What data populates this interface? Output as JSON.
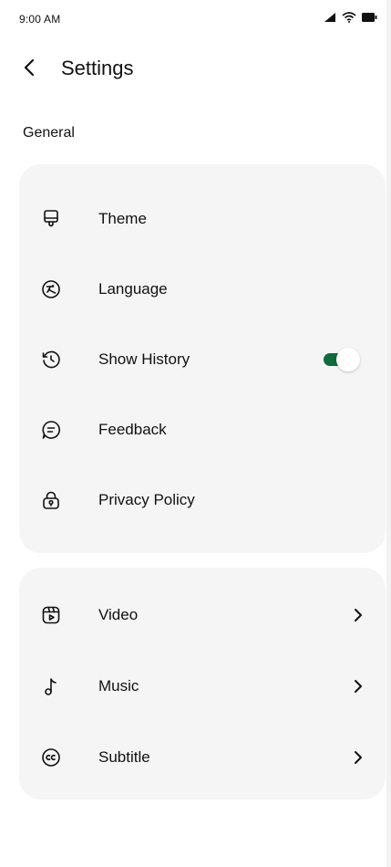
{
  "status_bar": {
    "time": "9:00 AM",
    "icons": [
      "cellular-signal-icon",
      "wifi-icon",
      "battery-icon"
    ]
  },
  "header": {
    "back_icon": "chevron-left-icon",
    "title": "Settings"
  },
  "general": {
    "section_label": "General",
    "items": [
      {
        "label": "Theme",
        "icon": "theme-icon"
      },
      {
        "label": "Language",
        "icon": "language-icon"
      },
      {
        "label": "Show History",
        "icon": "history-icon",
        "toggle": true
      },
      {
        "label": "Feedback",
        "icon": "feedback-icon"
      },
      {
        "label": "Privacy Policy",
        "icon": "lock-icon"
      }
    ]
  },
  "media": {
    "items": [
      {
        "label": "Video",
        "icon": "video-icon"
      },
      {
        "label": "Music",
        "icon": "music-note-icon"
      },
      {
        "label": "Subtitle",
        "icon": "closed-caption-icon"
      }
    ]
  },
  "colors": {
    "toggle_on": "#0f6b3b",
    "card_bg": "#f5f5f5",
    "text": "#111111"
  }
}
